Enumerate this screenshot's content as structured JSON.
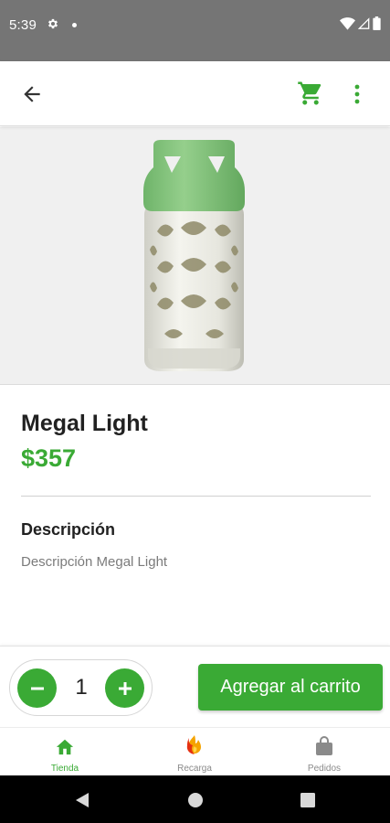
{
  "status_bar": {
    "time": "5:39",
    "icons": [
      "gear-icon",
      "notification-dot-icon",
      "wifi-icon",
      "signal-icon",
      "battery-icon"
    ]
  },
  "app_bar": {
    "back_icon": "arrow-back-icon",
    "cart_icon": "shopping-cart-icon",
    "more_icon": "more-vert-icon"
  },
  "product": {
    "image": "gas-cylinder-image",
    "name": "Megal Light",
    "price": "$357",
    "description_title": "Descripción",
    "description": "Descripción Megal Light"
  },
  "purchase": {
    "quantity": "1",
    "minus_icon": "minus-icon",
    "plus_icon": "plus-icon",
    "add_to_cart_label": "Agregar al carrito"
  },
  "bottom_nav": {
    "items": [
      {
        "label": "Tienda",
        "icon": "store-home-icon",
        "active": true
      },
      {
        "label": "Recarga",
        "icon": "flame-icon",
        "active": false
      },
      {
        "label": "Pedidos",
        "icon": "shopping-bag-icon",
        "active": false
      }
    ]
  },
  "system_nav": {
    "back": "triangle-back-icon",
    "home": "circle-home-icon",
    "recents": "square-recents-icon"
  },
  "colors": {
    "accent": "#3aaa35",
    "status_bar": "#757575",
    "image_background": "#f0f0f0"
  }
}
